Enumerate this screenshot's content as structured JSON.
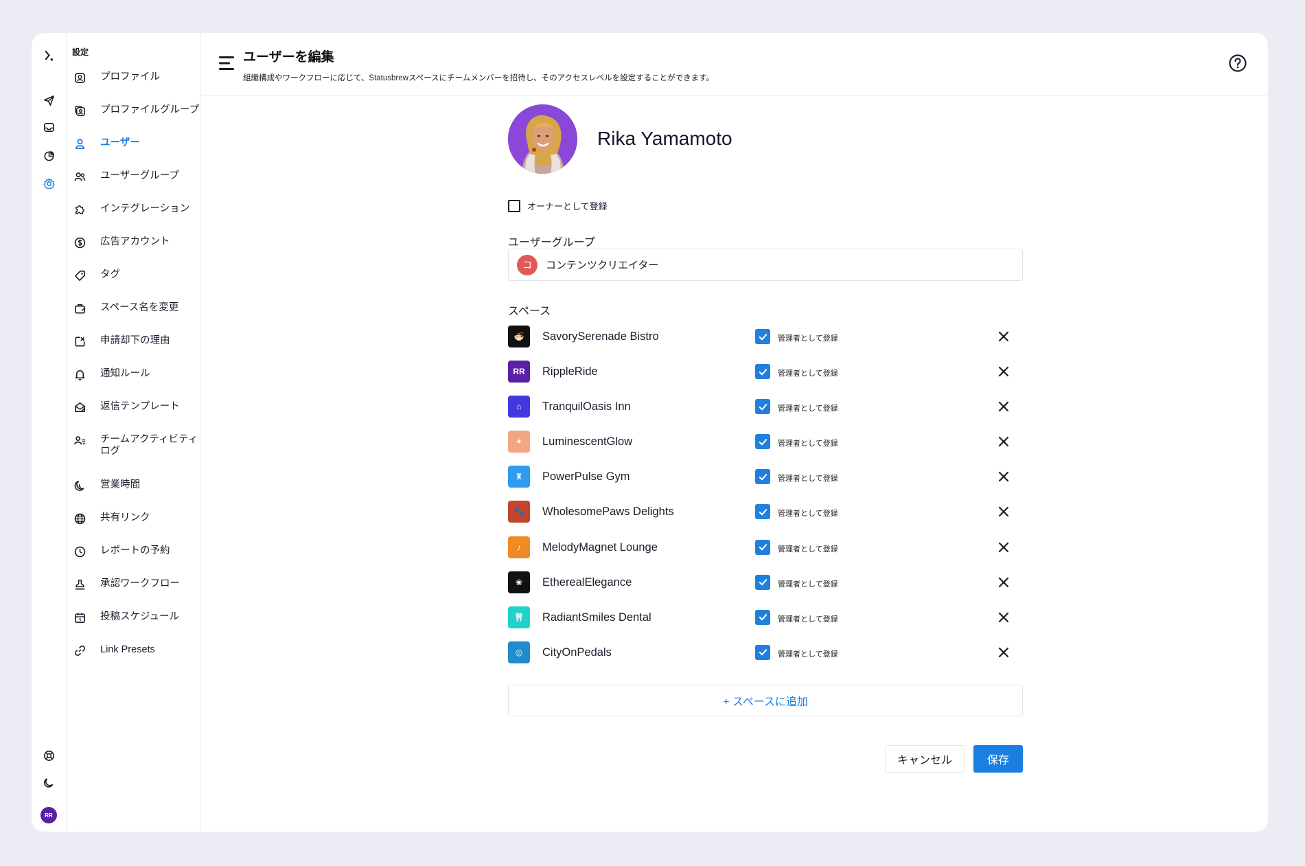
{
  "sidebar": {
    "title": "設定",
    "items": [
      {
        "label": "プロファイル",
        "icon": "profile-icon"
      },
      {
        "label": "プロファイルグループ",
        "icon": "profile-group-icon"
      },
      {
        "label": "ユーザー",
        "icon": "user-icon",
        "active": true
      },
      {
        "label": "ユーザーグループ",
        "icon": "users-icon"
      },
      {
        "label": "インテグレーション",
        "icon": "puzzle-icon"
      },
      {
        "label": "広告アカウント",
        "icon": "dollar-icon"
      },
      {
        "label": "タグ",
        "icon": "tag-icon"
      },
      {
        "label": "スペース名を変更",
        "icon": "briefcase-icon"
      },
      {
        "label": "申請却下の理由",
        "icon": "reject-icon"
      },
      {
        "label": "通知ルール",
        "icon": "bell-icon"
      },
      {
        "label": "返信テンプレート",
        "icon": "mail-template-icon"
      },
      {
        "label": "チームアクティビティログ",
        "icon": "team-activity-icon"
      },
      {
        "label": "営業時間",
        "icon": "moon-clock-icon"
      },
      {
        "label": "共有リンク",
        "icon": "globe-icon"
      },
      {
        "label": "レポートの予約",
        "icon": "clock-icon"
      },
      {
        "label": "承認ワークフロー",
        "icon": "stamp-icon"
      },
      {
        "label": "投稿スケジュール",
        "icon": "calendar-icon"
      },
      {
        "label": "Link Presets",
        "icon": "link-icon"
      }
    ]
  },
  "rail": {
    "avatar_text": "RR"
  },
  "header": {
    "title": "ユーザーを編集",
    "description": "組織構成やワークフローに応じて、Statusbrewスペースにチームメンバーを招待し、そのアクセスレベルを設定することができます。"
  },
  "user": {
    "name": "Rika Yamamoto"
  },
  "owner": {
    "label": "オーナーとして登録",
    "checked": false
  },
  "user_group": {
    "label": "ユーザーグループ",
    "badge": "コ",
    "name": "コンテンツクリエイター",
    "badge_color": "#e05a5a"
  },
  "spaces": {
    "label": "スペース",
    "admin_label": "管理者として登録",
    "items": [
      {
        "name": "SavorySerenade Bistro",
        "color": "#111111",
        "glyph": "🍜"
      },
      {
        "name": "RippleRide",
        "color": "#5b1fa6",
        "glyph": "RR"
      },
      {
        "name": "TranquilOasis Inn",
        "color": "#4338e0",
        "glyph": "⌂"
      },
      {
        "name": "LuminescentGlow",
        "color": "#f4a582",
        "glyph": "✦"
      },
      {
        "name": "PowerPulse Gym",
        "color": "#2d9cf0",
        "glyph": "♜"
      },
      {
        "name": "WholesomePaws Delights",
        "color": "#c2462d",
        "glyph": "🐾"
      },
      {
        "name": "MelodyMagnet Lounge",
        "color": "#f08a24",
        "glyph": "♪"
      },
      {
        "name": "EtherealElegance",
        "color": "#111111",
        "glyph": "❀"
      },
      {
        "name": "RadiantSmiles Dental",
        "color": "#20d3c8",
        "glyph": "🦷"
      },
      {
        "name": "CityOnPedals",
        "color": "#1f8ccc",
        "glyph": "◎"
      }
    ]
  },
  "actions": {
    "add_space": "+ スペースに追加",
    "cancel": "キャンセル",
    "save": "保存"
  },
  "colors": {
    "accent": "#1a7fe0"
  }
}
